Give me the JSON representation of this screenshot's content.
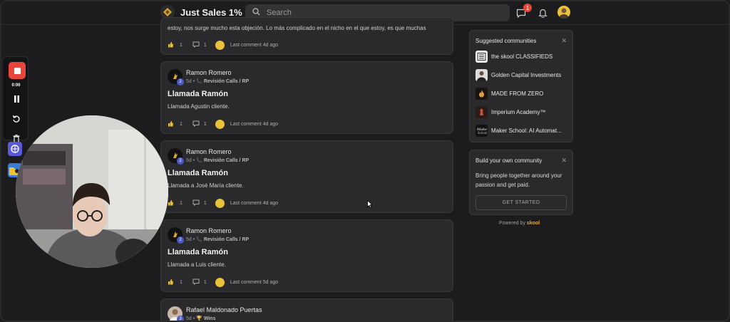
{
  "topbar": {
    "community_name": "Just Sales 1%",
    "search_placeholder": "Search",
    "notification_count": "1"
  },
  "posts": [
    {
      "body": "estoy, nos surge mucho esta objeción. Lo más complicado en el nicho en el que estoy, es que muchas",
      "likes": "1",
      "comments": "1",
      "last_comment": "Last comment 4d ago"
    },
    {
      "author": "Ramon Romero",
      "level": "2",
      "time": "5d",
      "category": "Revisión Calls / RP",
      "title": "Llamada Ramón",
      "body": "Llamada Agustin cliente.",
      "likes": "1",
      "comments": "1",
      "last_comment": "Last comment 4d ago"
    },
    {
      "author": "Ramon Romero",
      "level": "2",
      "time": "5d",
      "category": "Revisión Calls / RP",
      "title": "Llamada Ramón",
      "body": "Llamada a José María cliente.",
      "likes": "1",
      "comments": "1",
      "last_comment": "Last comment 4d ago"
    },
    {
      "author": "Ramon Romero",
      "level": "2",
      "time": "5d",
      "category": "Revisión Calls / RP",
      "title": "Llamada Ramón",
      "body": "Llamada a Luis cliente.",
      "likes": "1",
      "comments": "1",
      "last_comment": "Last comment 5d ago"
    },
    {
      "author": "Rafael Maldonado Puertas",
      "level": "3",
      "time": "5d",
      "category": "Wins"
    }
  ],
  "suggested": {
    "title": "Suggested communities",
    "items": [
      {
        "name": "the skool CLASSIFIEDS",
        "icon": "newspaper-icon"
      },
      {
        "name": "Golden Capital Investments",
        "icon": "person-photo-icon"
      },
      {
        "name": "MADE FROM ZERO",
        "icon": "flame-icon"
      },
      {
        "name": "Imperium Academy™",
        "icon": "warrior-icon"
      },
      {
        "name": "Maker School: AI Automat...",
        "icon": "maker-logo-icon"
      }
    ]
  },
  "build": {
    "title": "Build your own community",
    "text": "Bring people together around your passion and get paid.",
    "button": "GET STARTED"
  },
  "footer": {
    "powered_by": "Powered by",
    "brand": "skool"
  },
  "recorder": {
    "time": "0:00"
  },
  "colors": {
    "background": "#1c1c1e",
    "card": "#2a2a2c",
    "record_red": "#e8463c",
    "badge_red": "#e5463a",
    "level_blue": "#4a5ac8"
  }
}
